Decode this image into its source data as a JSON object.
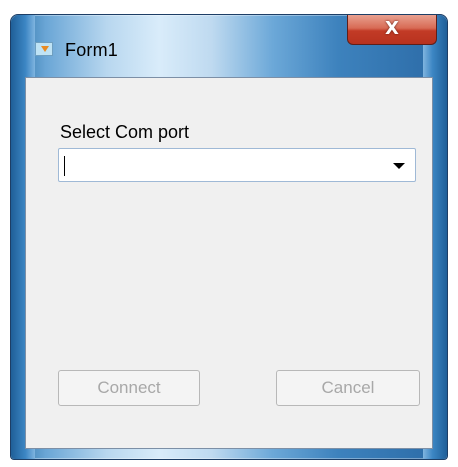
{
  "window": {
    "title": "Form1"
  },
  "icons": {
    "app_icon": "application-icon",
    "close_icon": "close-icon",
    "dropdown_icon": "chevron-down-icon"
  },
  "title_controls": {
    "close_glyph": "X"
  },
  "form": {
    "label": "Select Com port",
    "combo": {
      "value": ""
    },
    "buttons": {
      "connect": "Connect",
      "cancel": "Cancel"
    }
  },
  "colors": {
    "close_button": "#c23b26",
    "client_bg": "#f0f0f0",
    "disabled_text": "#a8a8a8"
  }
}
